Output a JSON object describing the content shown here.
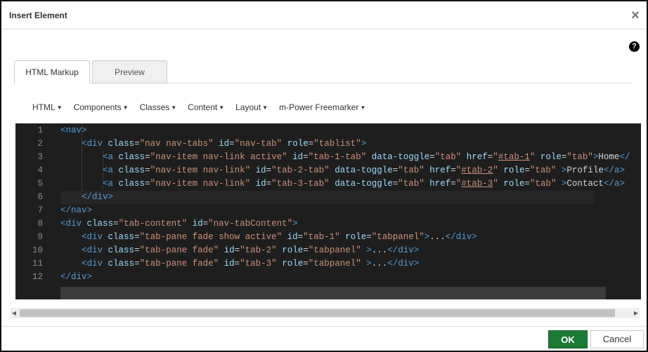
{
  "dialog": {
    "title": "Insert Element",
    "close_glyph": "×",
    "help_glyph": "?"
  },
  "tabs": [
    {
      "label": "HTML Markup",
      "active": true
    },
    {
      "label": "Preview",
      "active": false
    }
  ],
  "menu": [
    {
      "label": "HTML"
    },
    {
      "label": "Components"
    },
    {
      "label": "Classes"
    },
    {
      "label": "Content"
    },
    {
      "label": "Layout"
    },
    {
      "label": "m-Power Freemarker"
    }
  ],
  "code_lines": [
    {
      "number": "1",
      "text": "<nav>"
    },
    {
      "number": "2",
      "text": "    <div class=\"nav nav-tabs\" id=\"nav-tab\" role=\"tablist\">"
    },
    {
      "number": "3",
      "text": "        <a class=\"nav-item nav-link active\" id=\"tab-1-tab\" data-toggle=\"tab\" href=\"#tab-1\" role=\"tab\">Home</"
    },
    {
      "number": "4",
      "text": "        <a class=\"nav-item nav-link\" id=\"tab-2-tab\" data-toggle=\"tab\" href=\"#tab-2\" role=\"tab\" >Profile</a>"
    },
    {
      "number": "5",
      "text": "        <a class=\"nav-item nav-link\" id=\"tab-3-tab\" data-toggle=\"tab\" href=\"#tab-3\" role=\"tab\" >Contact</a>"
    },
    {
      "number": "6",
      "text": "    </div>"
    },
    {
      "number": "7",
      "text": "</nav>"
    },
    {
      "number": "8",
      "text": "<div class=\"tab-content\" id=\"nav-tabContent\">"
    },
    {
      "number": "9",
      "text": "    <div class=\"tab-pane fade show active\" id=\"tab-1\" role=\"tabpanel\">...</div>"
    },
    {
      "number": "10",
      "text": "    <div class=\"tab-pane fade\" id=\"tab-2\" role=\"tabpanel\" >...</div>"
    },
    {
      "number": "11",
      "text": "    <div class=\"tab-pane fade\" id=\"tab-3\" role=\"tabpanel\" >...</div>"
    },
    {
      "number": "12",
      "text": "</div>"
    }
  ],
  "current_line": "6",
  "colors": {
    "editor_bg": "#1e1e1e",
    "tag": "#569cd6",
    "attribute": "#9cdcfe",
    "string": "#ce9178",
    "ok_button": "#1c7a36"
  },
  "footer": {
    "ok_label": "OK",
    "cancel_label": "Cancel"
  }
}
